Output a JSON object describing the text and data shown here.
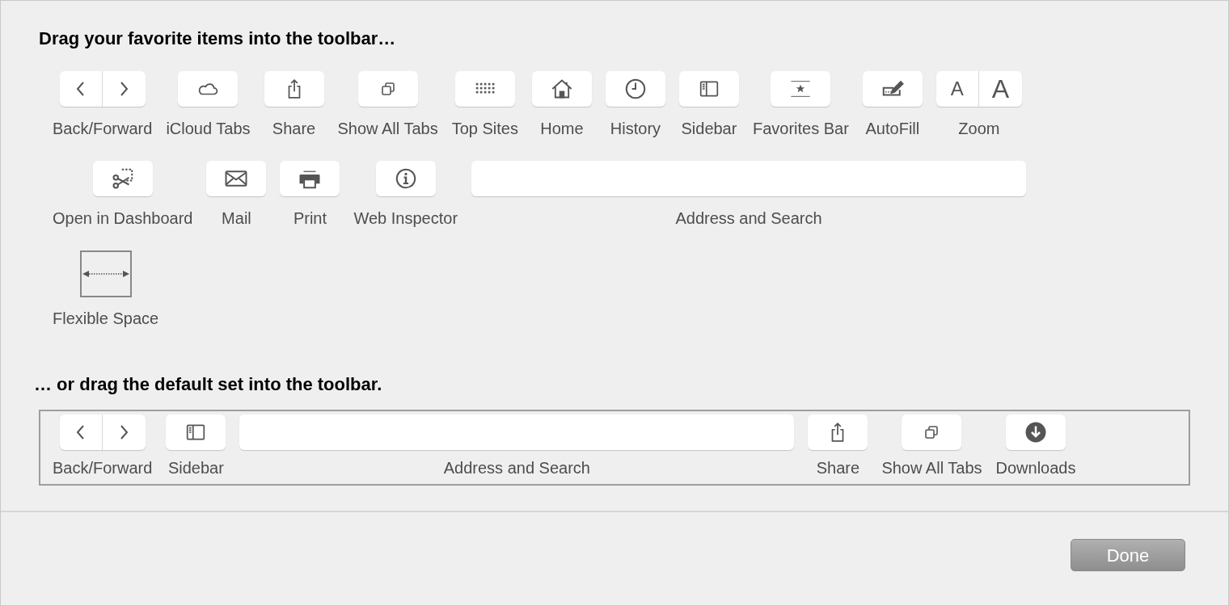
{
  "heading": "Drag your favorite items into the toolbar…",
  "palette_rows": [
    {
      "items": [
        {
          "kind": "backforward",
          "label": "Back/Forward"
        },
        {
          "kind": "icloud",
          "label": "iCloud Tabs"
        },
        {
          "kind": "share",
          "label": "Share"
        },
        {
          "kind": "tabs",
          "label": "Show All Tabs"
        },
        {
          "kind": "topsites",
          "label": "Top Sites"
        },
        {
          "kind": "home",
          "label": "Home"
        },
        {
          "kind": "history",
          "label": "History"
        },
        {
          "kind": "sidebar",
          "label": "Sidebar"
        },
        {
          "kind": "favorites",
          "label": "Favorites Bar"
        },
        {
          "kind": "autofill",
          "label": "AutoFill"
        },
        {
          "kind": "zoom",
          "label": "Zoom",
          "glyphs": [
            "A",
            "A"
          ]
        }
      ]
    },
    {
      "items": [
        {
          "kind": "dashboard",
          "label": "Open in Dashboard"
        },
        {
          "kind": "mail",
          "label": "Mail"
        },
        {
          "kind": "print",
          "label": "Print"
        },
        {
          "kind": "inspector",
          "label": "Web Inspector"
        },
        {
          "kind": "address",
          "label": "Address and Search"
        }
      ]
    },
    {
      "items": [
        {
          "kind": "flexspace",
          "label": "Flexible Space"
        }
      ]
    }
  ],
  "default_heading": "… or drag the default set into the toolbar.",
  "default_set": {
    "items": [
      {
        "kind": "backforward",
        "label": "Back/Forward"
      },
      {
        "kind": "sidebar",
        "label": "Sidebar"
      },
      {
        "kind": "address",
        "label": "Address and Search"
      },
      {
        "kind": "share",
        "label": "Share"
      },
      {
        "kind": "tabs",
        "label": "Show All Tabs"
      },
      {
        "kind": "downloads",
        "label": "Downloads"
      }
    ]
  },
  "done_button": "Done"
}
